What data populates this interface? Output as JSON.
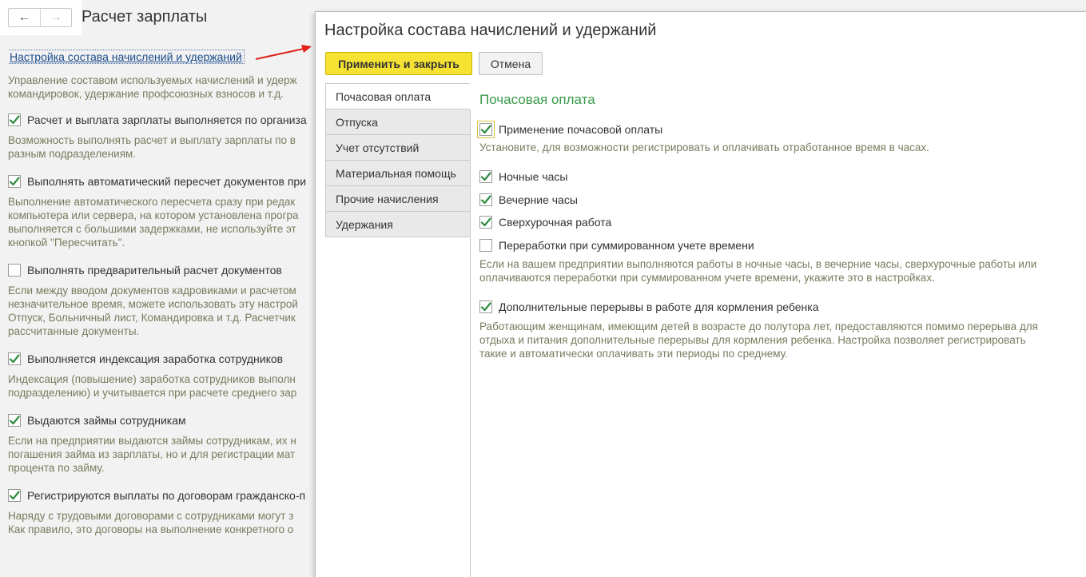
{
  "background": {
    "nav_back_icon": "arrow-left-icon",
    "nav_forward_icon": "arrow-right-icon",
    "title": "Расчет зарплаты",
    "link": "Настройка состава начислений и удержаний",
    "link_desc": [
      "Управление составом используемых начислений и удерж",
      "командировок, удержание профсоюзных взносов и т.д."
    ],
    "sections": [
      {
        "checked": true,
        "label": "Расчет и выплата зарплаты выполняется по организа",
        "desc": [
          "Возможность выполнять расчет и выплату зарплаты по в",
          "разным подразделениям."
        ]
      },
      {
        "checked": true,
        "label": "Выполнять автоматический пересчет документов при",
        "desc": [
          "Выполнение автоматического пересчета сразу при редак",
          "компьютера или сервера, на котором установлена програ",
          "выполняется с большими задержками, не используйте эт",
          "кнопкой \"Пересчитать\"."
        ]
      },
      {
        "checked": false,
        "label": "Выполнять предварительный расчет документов",
        "desc": [
          "Если между вводом документов кадровиками и расчетом",
          "незначительное время, можете использовать эту настрой",
          "Отпуск, Больничный лист, Командировка и т.д. Расчетчик",
          "рассчитанные документы."
        ]
      },
      {
        "checked": true,
        "label": "Выполняется индексация заработка сотрудников",
        "desc": [
          "Индексация (повышение) заработка сотрудников выполн",
          "подразделению) и учитывается при расчете среднего зар"
        ]
      },
      {
        "checked": true,
        "label": "Выдаются займы сотрудникам",
        "desc": [
          "Если на предприятии выдаются займы сотрудникам, их н",
          "погашения займа из зарплаты, но и для регистрации мат",
          "процента по займу."
        ]
      },
      {
        "checked": true,
        "label": "Регистрируются выплаты по договорам гражданско-п",
        "desc": [
          "Наряду с трудовыми договорами с сотрудниками могут з",
          "Как правило, это договоры на выполнение конкретного о"
        ]
      }
    ]
  },
  "dialog": {
    "title": "Настройка состава начислений и удержаний",
    "apply_label": "Применить и закрыть",
    "cancel_label": "Отмена",
    "tabs": [
      {
        "label": "Почасовая оплата",
        "active": true
      },
      {
        "label": "Отпуска",
        "active": false
      },
      {
        "label": "Учет отсутствий",
        "active": false
      },
      {
        "label": "Материальная помощь",
        "active": false
      },
      {
        "label": "Прочие начисления",
        "active": false
      },
      {
        "label": "Удержания",
        "active": false
      }
    ],
    "panel": {
      "title": "Почасовая оплата",
      "main_option": {
        "label": "Применение почасовой оплаты",
        "checked": true
      },
      "main_desc": "Установите, для возможности регистрировать и оплачивать отработанное время в часах.",
      "options": [
        {
          "label": "Ночные часы",
          "checked": true
        },
        {
          "label": "Вечерние часы",
          "checked": true
        },
        {
          "label": "Сверхурочная работа",
          "checked": true
        },
        {
          "label": "Переработки при суммированном учете времени",
          "checked": false
        }
      ],
      "options_desc": [
        "Если на вашем предприятии выполняются работы в ночные часы, в вечерние часы, сверхурочные работы или",
        "оплачиваются переработки при суммированном учете времени, укажите это в настройках."
      ],
      "feeding": {
        "label": "Дополнительные перерывы в работе для кормления ребенка",
        "checked": true
      },
      "feeding_desc": [
        "Работающим женщинам, имеющим детей в возрасте до полутора лет, предоставляются помимо перерыва для",
        "отдыха и питания дополнительные перерывы для кормления ребенка. Настройка позволяет регистрировать",
        "такие и автоматически оплачивать эти периоды по среднему."
      ]
    }
  },
  "colors": {
    "accent_yellow": "#f5e232",
    "section_green": "#3a9a4a",
    "desc_text": "#7a7a5e",
    "link_blue": "#1a4c8c",
    "arrow_red": "#e0221a"
  }
}
